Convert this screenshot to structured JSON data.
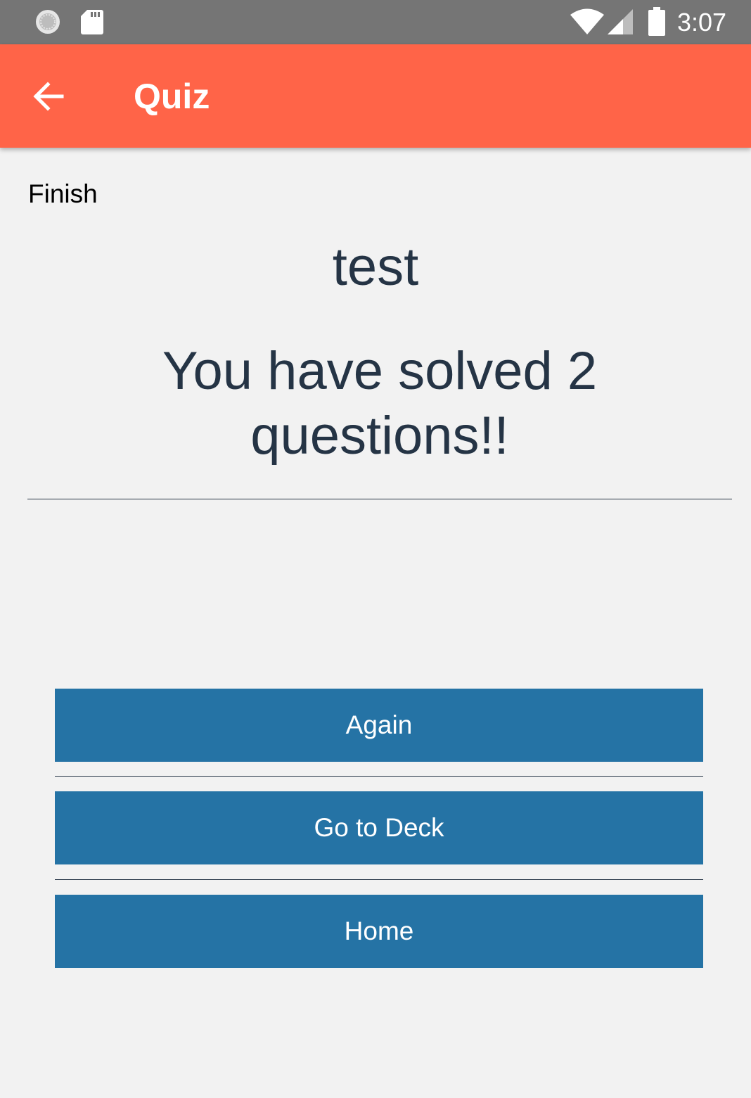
{
  "status_bar": {
    "time": "3:07",
    "icons": [
      "sync-icon",
      "sd-card-icon",
      "wifi-icon",
      "cell-signal-icon",
      "battery-icon"
    ],
    "background": "#757575"
  },
  "app_bar": {
    "title": "Quiz",
    "back_icon": "arrow-back-icon",
    "background": "#ff6448"
  },
  "content": {
    "section_label": "Finish",
    "deck_name": "test",
    "result_message": "You have solved 2 questions!!",
    "text_color": "#253445"
  },
  "actions": {
    "again_label": "Again",
    "deck_label": "Go to Deck",
    "home_label": "Home",
    "button_color": "#2573a5"
  }
}
